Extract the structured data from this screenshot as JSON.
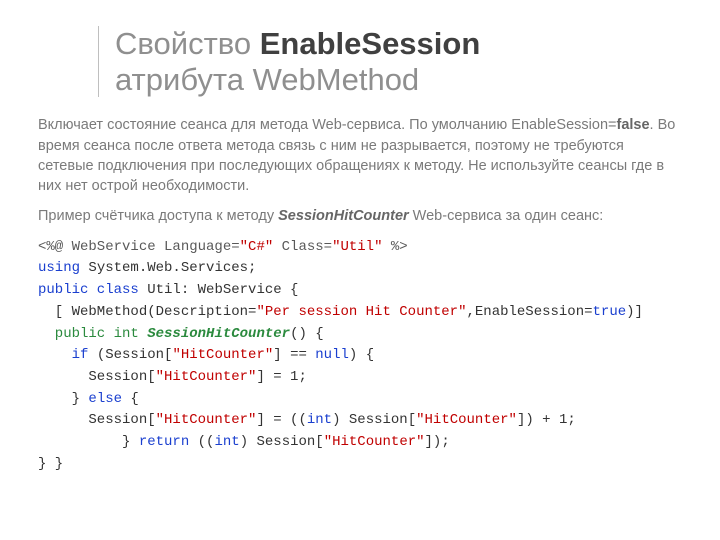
{
  "title": {
    "pre": "Свойство ",
    "strong": "EnableSession",
    "line2": "атрибута WebMethod"
  },
  "para1": {
    "t1": "Включает состояние сеанса для метода Web-сервиса. По умолчанию EnableSession=",
    "false": "false",
    "t2": ". Во время сеанса после ответа метода связь с ним не разрывается, поэтому не требуются сетевые подключения при последующих обращениях к методу. Не используйте сеансы где в них нет острой необходимости."
  },
  "para2": {
    "t1": "Пример счётчика доступа к методу ",
    "meth": "SessionHitCounter",
    "t2": " Web-сервиса за один сеанс:"
  },
  "code": {
    "l1a": "<%@ WebService Language=",
    "l1b": "\"C#\"",
    "l1c": " Class=",
    "l1d": "\"Util\"",
    "l1e": " %>",
    "l2a": "using",
    "l2b": " System.Web.Services;",
    "l3a": "public class",
    "l3b": " Util: WebService {",
    "l4a": "  [ WebMethod(Description=",
    "l4b": "\"Per session Hit Counter\"",
    "l4c": ",EnableSession=",
    "l4d": "true",
    "l4e": ")]",
    "l5a": "  public int",
    "l5b": " SessionHitCounter",
    "l5c": "() {",
    "l6a": "    if",
    "l6b": " (Session[",
    "l6c": "\"HitCounter\"",
    "l6d": "] == ",
    "l6e": "null",
    "l6f": ") {",
    "l7a": "      Session[",
    "l7b": "\"HitCounter\"",
    "l7c": "] = 1;",
    "l8a": "    } ",
    "l8b": "else",
    "l8c": " {",
    "l9a": "      Session[",
    "l9b": "\"HitCounter\"",
    "l9c": "] = ((",
    "l9d": "int",
    "l9e": ") Session[",
    "l9f": "\"HitCounter\"",
    "l9g": "]) + 1;",
    "l10a": "          } ",
    "l10b": "return",
    "l10c": " ((",
    "l10d": "int",
    "l10e": ") Session[",
    "l10f": "\"HitCounter\"",
    "l10g": "]);",
    "l11": "} }"
  }
}
